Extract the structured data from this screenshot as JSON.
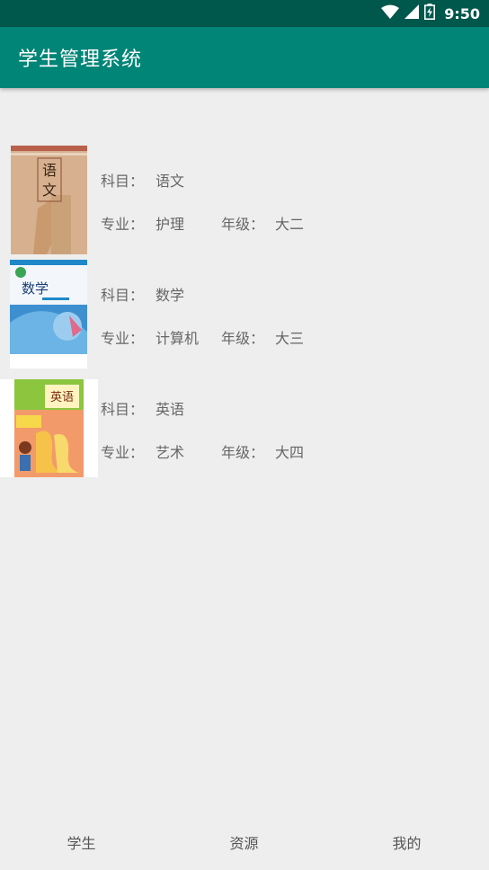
{
  "status_bar": {
    "time": "9:50",
    "icons": [
      "wifi-icon",
      "cell-signal-icon",
      "battery-icon"
    ]
  },
  "app_bar": {
    "title": "学生管理系统",
    "color": "#008577"
  },
  "list": {
    "subject_label": "科目：",
    "major_label": "专业：",
    "grade_label": "年级：",
    "items": [
      {
        "cover": "chinese-textbook-cover",
        "subject": "语文",
        "major": "护理",
        "grade": "大二"
      },
      {
        "cover": "math-textbook-cover",
        "subject": "数学",
        "major": "计算机",
        "grade": "大三"
      },
      {
        "cover": "english-textbook-cover",
        "subject": "英语",
        "major": "艺术",
        "grade": "大四"
      }
    ]
  },
  "bottom_nav": {
    "tabs": [
      {
        "label": "学生"
      },
      {
        "label": "资源"
      },
      {
        "label": "我的"
      }
    ]
  }
}
